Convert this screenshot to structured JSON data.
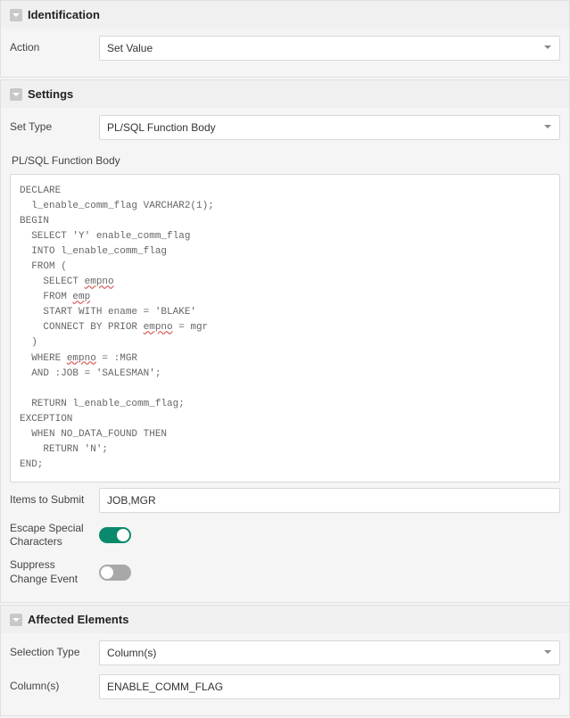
{
  "sections": {
    "identification": {
      "title": "Identification",
      "action_label": "Action",
      "action_value": "Set Value"
    },
    "settings": {
      "title": "Settings",
      "set_type_label": "Set Type",
      "set_type_value": "PL/SQL Function Body",
      "body_label": "PL/SQL Function Body",
      "code": {
        "l1": "DECLARE",
        "l2": "  l_enable_comm_flag VARCHAR2(1);",
        "l3": "BEGIN",
        "l4": "  SELECT 'Y' enable_comm_flag",
        "l5": "  INTO l_enable_comm_flag",
        "l6": "  FROM (",
        "l7a": "    SELECT ",
        "l7b": "empno",
        "l8a": "    FROM ",
        "l8b": "emp",
        "l9": "    START WITH ename = 'BLAKE'",
        "l10a": "    CONNECT BY PRIOR ",
        "l10b": "empno",
        "l10c": " = mgr",
        "l11": "  )",
        "l12a": "  WHERE ",
        "l12b": "empno",
        "l12c": " = :MGR",
        "l13": "  AND :JOB = 'SALESMAN';",
        "l14": "",
        "l15": "  RETURN l_enable_comm_flag;",
        "l16": "EXCEPTION",
        "l17": "  WHEN NO_DATA_FOUND THEN",
        "l18": "    RETURN 'N';",
        "l19": "END;"
      },
      "items_to_submit_label": "Items to Submit",
      "items_to_submit_value": "JOB,MGR",
      "escape_label": "Escape Special Characters",
      "escape_value": true,
      "suppress_label": "Suppress Change Event",
      "suppress_value": false
    },
    "affected": {
      "title": "Affected Elements",
      "selection_type_label": "Selection Type",
      "selection_type_value": "Column(s)",
      "columns_label": "Column(s)",
      "columns_value": "ENABLE_COMM_FLAG"
    }
  },
  "colors": {
    "toggle_on": "#0a8a6c",
    "toggle_off": "#a8a8a8"
  }
}
